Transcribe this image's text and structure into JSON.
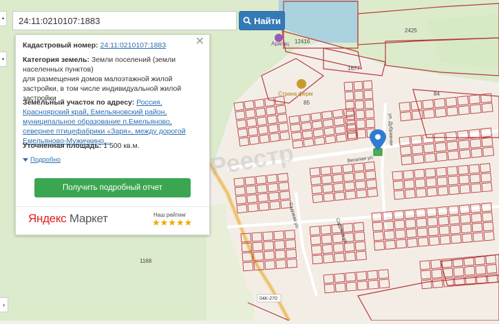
{
  "search": {
    "value": "24:11:0210107:1883",
    "button_label": "Найти"
  },
  "info_card": {
    "cadastral_label": "Кадастровый номер:",
    "cadastral_value": "24:11:0210107:1883",
    "category_label": "Категория земель:",
    "category_value": "Земли поселений (земли населенных пунктов)",
    "usage_text": "для размещения домов малоэтажной жилой застройки, в том числе индивидуальной жилой застройки",
    "address_label": "Земельный участок по адресу:",
    "address_value": "Россия, Красноярский край, Емельяновский район, муниципальное образование п.Емельяново, севернее птицефабрики «Заря», между дорогой Емельяново-Мужичкино...",
    "area_label": "Уточненная площадь:",
    "area_value": "1 500 кв.м.",
    "details_link": "Подробно",
    "report_button": "Получить подробный отчет",
    "ym_logo_part1": "Яндекс",
    "ym_logo_part2": "Маркет",
    "ym_rating_label": "Наш рейтинг",
    "ym_stars": "★★★★★"
  },
  "map_labels": {
    "num_2425": "2425",
    "num_12416": "12416",
    "num_1677": "1677",
    "num_84": "84",
    "num_85": "85",
    "num_1168": "1168",
    "road_label": "04К-270",
    "poi_aragats": "Арагац",
    "poi_farm": "Страна ферм",
    "street_1": "Веселая ул.",
    "street_2": "ул. Дубравная",
    "street_3": "Садовая ул.",
    "street_4": "Садовая ул.",
    "watermark": "Реестр"
  },
  "colors": {
    "parcel": "#b8383b",
    "water": "#aad3df",
    "park": "#d6eac5",
    "button_blue": "#337ab7",
    "button_green": "#3aa651",
    "marker": "#2f7bd1"
  },
  "icons": {
    "search": "search-icon",
    "close": "close-icon",
    "marker": "map-marker-icon",
    "expand": "triangle-down-icon"
  }
}
